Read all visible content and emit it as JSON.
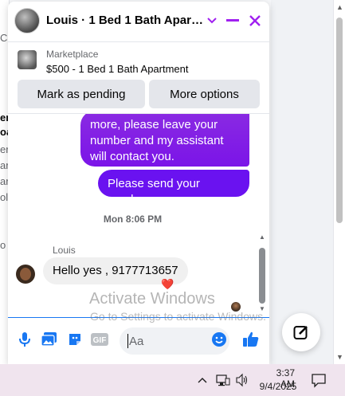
{
  "window": {
    "title": "Louis · 1 Bed 1 Bath Apart…"
  },
  "listing": {
    "label": "Marketplace",
    "detail": "$500 - 1 Bed 1 Bath Apartment"
  },
  "actions": {
    "pending_label": "Mark as pending",
    "more_label": "More options"
  },
  "messages": {
    "outgoing_1": "more, please leave your number and my assistant will contact you.",
    "outgoing_2": "Please send your number",
    "timestamp": "Mon 8:06 PM",
    "sender": "Louis",
    "incoming_1": "Hello yes , 9177713657",
    "reaction": "❤️"
  },
  "composer": {
    "placeholder": "Aa"
  },
  "watermark": {
    "line1": "Activate Windows",
    "line2": "Go to Settings to activate Windows."
  },
  "taskbar": {
    "time": "3:37 AM",
    "date": "9/4/2025"
  },
  "background": {
    "fragments": [
      "C",
      "en",
      "oa",
      "er",
      "ar",
      "ar",
      "ol",
      "o"
    ]
  },
  "colors": {
    "accent": "#a020f0",
    "bubble_gradient_top": "#8a2be2",
    "bubble_solid": "#6a12f0",
    "link_blue": "#1877f2"
  }
}
